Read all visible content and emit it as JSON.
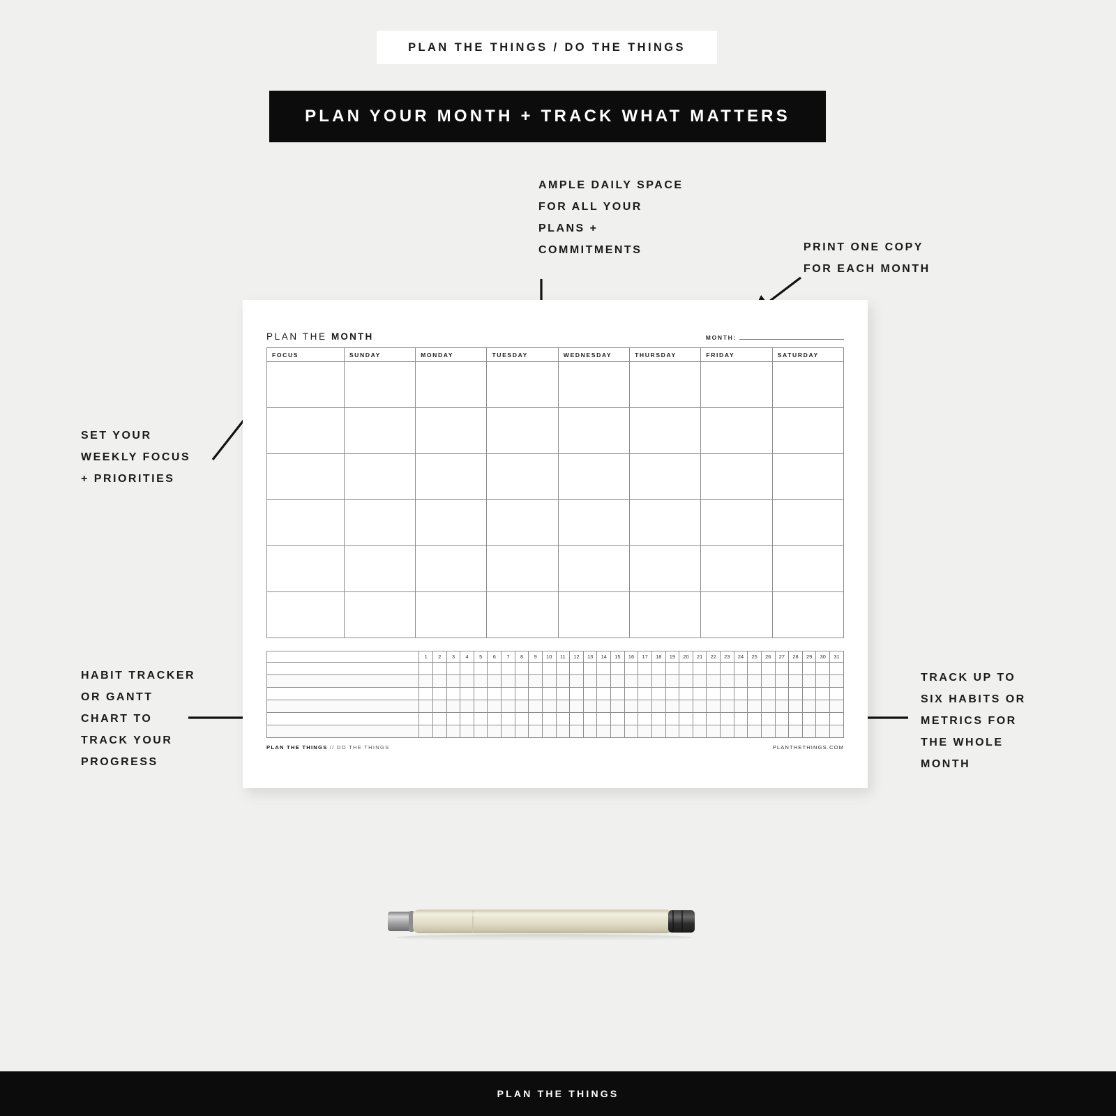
{
  "header": {
    "eyebrow": "PLAN THE THINGS / DO THE THINGS",
    "headline": "PLAN YOUR MONTH + TRACK WHAT MATTERS"
  },
  "callouts": {
    "ample_daily_space": [
      "AMPLE DAILY SPACE",
      "FOR ALL YOUR",
      "PLANS +",
      "COMMITMENTS"
    ],
    "print_one_copy": [
      "PRINT ONE COPY",
      "FOR EACH MONTH"
    ],
    "set_your_weekly_focus": [
      "SET YOUR",
      "WEEKLY FOCUS",
      "+ PRIORITIES"
    ],
    "habit_tracker": [
      "HABIT TRACKER",
      "OR GANTT",
      "CHART TO",
      "TRACK YOUR",
      "PROGRESS"
    ],
    "track_up_to_six": [
      "TRACK UP TO",
      "SIX HABITS OR",
      "METRICS FOR",
      "THE WHOLE",
      "MONTH"
    ]
  },
  "sheet": {
    "title_light": "PLAN THE ",
    "title_bold": "MONTH",
    "month_label": "MONTH:",
    "month_value": "",
    "columns": [
      "FOCUS",
      "SUNDAY",
      "MONDAY",
      "TUESDAY",
      "WEDNESDAY",
      "THURSDAY",
      "FRIDAY",
      "SATURDAY"
    ],
    "week_rows": 6,
    "tracker": {
      "days": [
        1,
        2,
        3,
        4,
        5,
        6,
        7,
        8,
        9,
        10,
        11,
        12,
        13,
        14,
        15,
        16,
        17,
        18,
        19,
        20,
        21,
        22,
        23,
        24,
        25,
        26,
        27,
        28,
        29,
        30,
        31
      ],
      "habit_rows": 6,
      "habit_labels": [
        "",
        "",
        "",
        "",
        "",
        ""
      ]
    },
    "footer": {
      "left_bold": "PLAN THE THINGS",
      "left_sep": " // ",
      "left_light": "DO THE THINGS",
      "right": "PLANTHETHINGS.COM"
    }
  },
  "footer_bar": {
    "label": "PLAN THE THINGS"
  },
  "colors": {
    "page_background": "#f0f0ef",
    "bar_black": "#0c0c0c",
    "sheet_white": "#ffffff",
    "grid_line": "#8d8d8d",
    "pen_body": "#ddd9c3",
    "pen_cap_dark": "#2b2b2b",
    "pen_tip_silver": "#9a9a9a"
  },
  "icons": {
    "arrow": "arrow-icon"
  }
}
